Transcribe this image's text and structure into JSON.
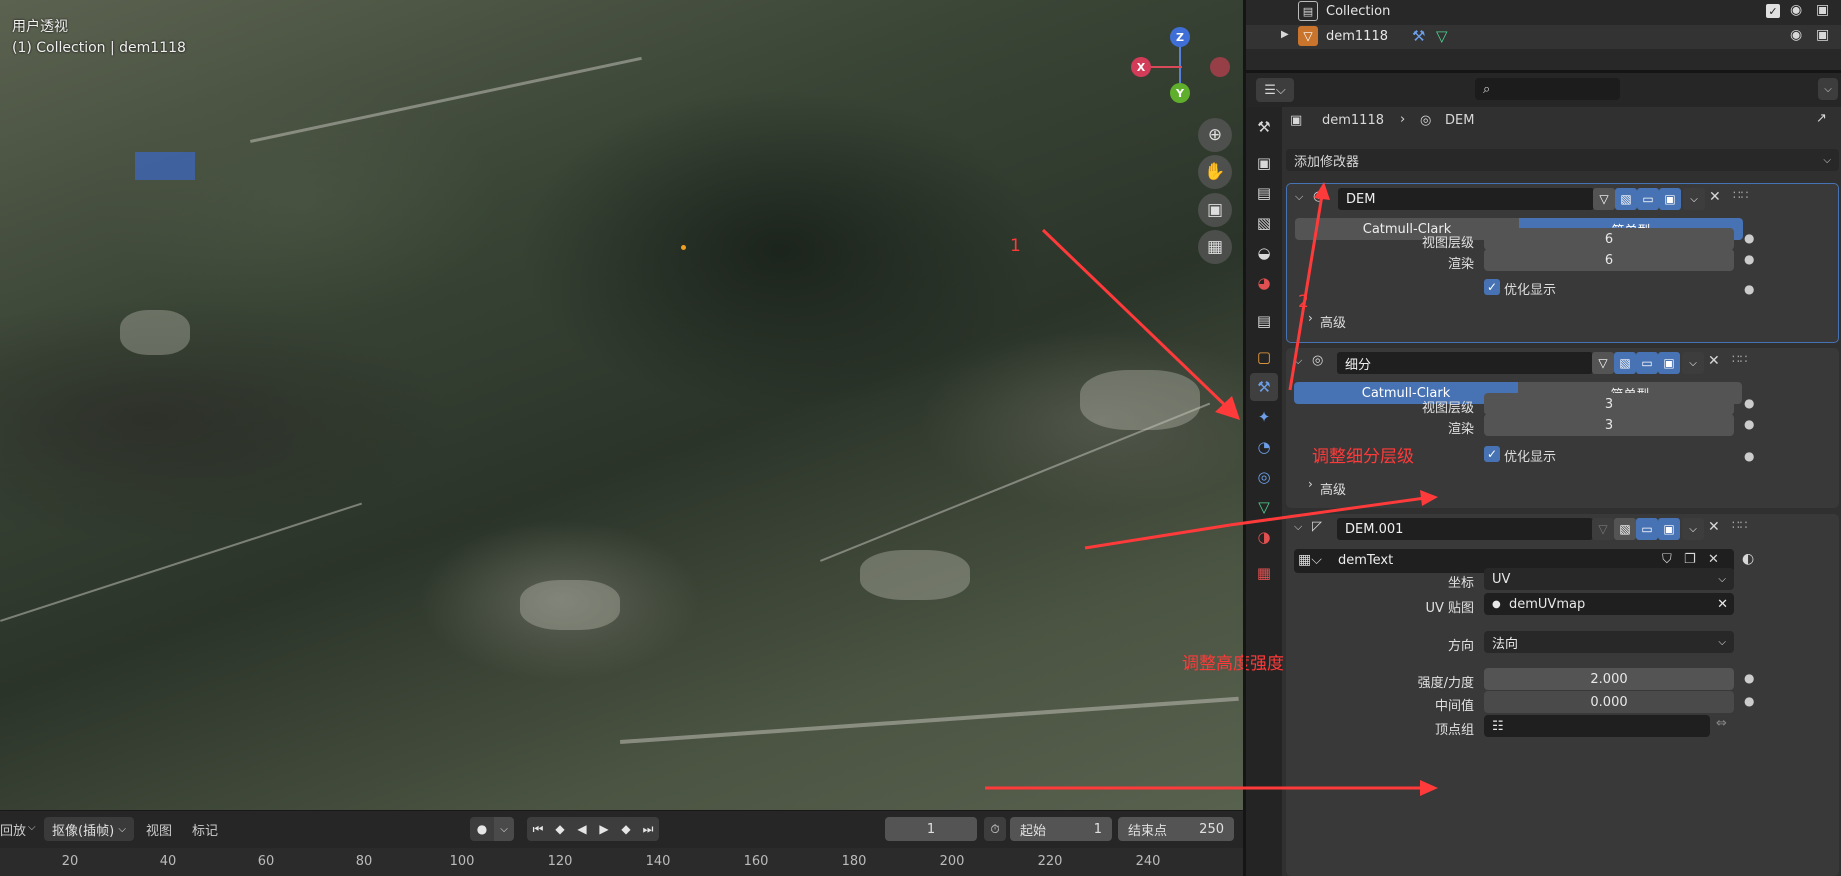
{
  "viewport": {
    "view_name": "用户透视",
    "collection_label": "(1) Collection | dem1118",
    "gizmo": {
      "z": "Z",
      "x": "X",
      "y": "Y"
    },
    "annotations": {
      "a1": "1",
      "a2": "2",
      "subdiv_note": "调整细分层级",
      "strength_note": "调整高度强度"
    }
  },
  "timeline": {
    "playback": "回放",
    "keying": "抠像(插帧)",
    "view": "视图",
    "marker": "标记",
    "current_frame": "1",
    "start_label": "起始",
    "start_value": "1",
    "end_label": "结束点",
    "end_value": "250",
    "ticks": [
      "20",
      "40",
      "60",
      "80",
      "100",
      "120",
      "140",
      "160",
      "180",
      "200",
      "220",
      "240"
    ]
  },
  "outliner": {
    "rows": [
      {
        "label": "Collection"
      },
      {
        "label": "dem1118"
      }
    ]
  },
  "properties": {
    "breadcrumb_object": "dem1118",
    "breadcrumb_modifier": "DEM",
    "add_modifier": "添加修改器",
    "modifiers": [
      {
        "name": "DEM",
        "seg_left": "Catmull-Clark",
        "seg_right": "简单型",
        "viewport_label": "视图层级",
        "viewport_value": "6",
        "render_label": "渲染",
        "render_value": "6",
        "optimal_label": "优化显示",
        "advanced_label": "高级"
      },
      {
        "name": "细分",
        "seg_left": "Catmull-Clark",
        "seg_right": "简单型",
        "viewport_label": "视图层级",
        "viewport_value": "3",
        "render_label": "渲染",
        "render_value": "3",
        "optimal_label": "优化显示",
        "advanced_label": "高级"
      },
      {
        "name": "DEM.001",
        "texture": "demText",
        "coords_label": "坐标",
        "coords_value": "UV",
        "uvmap_label": "UV 贴图",
        "uvmap_value": "demUVmap",
        "direction_label": "方向",
        "direction_value": "法向",
        "strength_label": "强度/力度",
        "strength_value": "2.000",
        "midlevel_label": "中间值",
        "midlevel_value": "0.000",
        "vgroup_label": "顶点组"
      }
    ]
  },
  "colors": {
    "accent": "#4772b3",
    "annotation": "#ff3a3a"
  }
}
